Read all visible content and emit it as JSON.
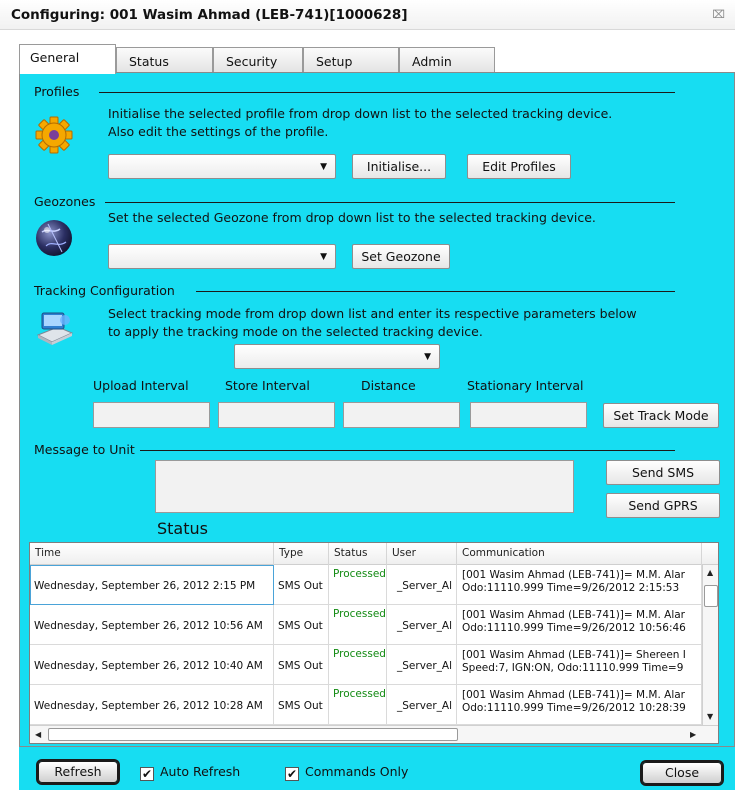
{
  "window": {
    "title": "Configuring: 001 Wasim Ahmad (LEB-741)[1000628]",
    "close_glyph": "⌧"
  },
  "tabs": [
    {
      "label": "General",
      "active": true
    },
    {
      "label": "Status",
      "active": false
    },
    {
      "label": "Security",
      "active": false
    },
    {
      "label": "Setup",
      "active": false
    },
    {
      "label": "Admin",
      "active": false
    }
  ],
  "profiles": {
    "heading": "Profiles",
    "description_line1": "Initialise the selected profile from drop down list to the selected tracking device.",
    "description_line2": "Also edit the settings of the profile.",
    "selected": "",
    "initialise_label": "Initialise...",
    "edit_label": "Edit Profiles",
    "icon": "gear-icon"
  },
  "geozones": {
    "heading": "Geozones",
    "description": "Set the selected Geozone from drop down list to the selected tracking device.",
    "selected": "",
    "set_label": "Set Geozone",
    "icon": "globe-icon"
  },
  "tracking": {
    "heading": "Tracking Configuration",
    "description_line1": "Select tracking mode from drop down list and enter its respective parameters below",
    "description_line2": "to apply the tracking mode on the selected tracking device.",
    "selected": "",
    "fields": [
      {
        "label": "Upload Interval",
        "value": ""
      },
      {
        "label": "Store Interval",
        "value": ""
      },
      {
        "label": "Distance",
        "value": ""
      },
      {
        "label": "Stationary Interval",
        "value": ""
      }
    ],
    "set_label": "Set Track Mode",
    "icon": "computer-icon"
  },
  "message": {
    "heading": "Message to Unit",
    "value": "",
    "send_sms_label": "Send SMS",
    "send_gprs_label": "Send GPRS"
  },
  "status": {
    "heading": "Status",
    "columns": [
      "Time",
      "Type",
      "Status",
      "User",
      "Communication"
    ],
    "rows": [
      {
        "time": "Wednesday, September 26, 2012 2:15 PM",
        "type": "SMS Out",
        "status": "Processed",
        "user": "_Server_Al",
        "comm1": "[001 Wasim Ahmad (LEB-741)]= M.M. Alar",
        "comm2": "Odo:11110.999 Time=9/26/2012 2:15:53"
      },
      {
        "time": "Wednesday, September 26, 2012 10:56 AM",
        "type": "SMS Out",
        "status": "Processed",
        "user": "_Server_Al",
        "comm1": "[001 Wasim Ahmad (LEB-741)]= M.M. Alar",
        "comm2": "Odo:11110.999 Time=9/26/2012 10:56:46"
      },
      {
        "time": "Wednesday, September 26, 2012 10:40 AM",
        "type": "SMS Out",
        "status": "Processed",
        "user": "_Server_Al",
        "comm1": "[001 Wasim Ahmad (LEB-741)]= Shereen I",
        "comm2": "Speed:7, IGN:ON, Odo:11110.999 Time=9"
      },
      {
        "time": "Wednesday, September 26, 2012 10:28 AM",
        "type": "SMS Out",
        "status": "Processed",
        "user": "_Server_Al",
        "comm1": "[001 Wasim Ahmad (LEB-741)]= M.M. Alar",
        "comm2": "Odo:11110.999 Time=9/26/2012 10:28:39"
      }
    ]
  },
  "bottom": {
    "refresh_label": "Refresh",
    "auto_refresh_label": "Auto Refresh",
    "auto_refresh_checked": true,
    "commands_only_label": "Commands Only",
    "commands_only_checked": true,
    "close_label": "Close",
    "check_glyph": "✔"
  },
  "colors": {
    "panel_bg": "#17ddf2",
    "processed": "#118a11"
  }
}
